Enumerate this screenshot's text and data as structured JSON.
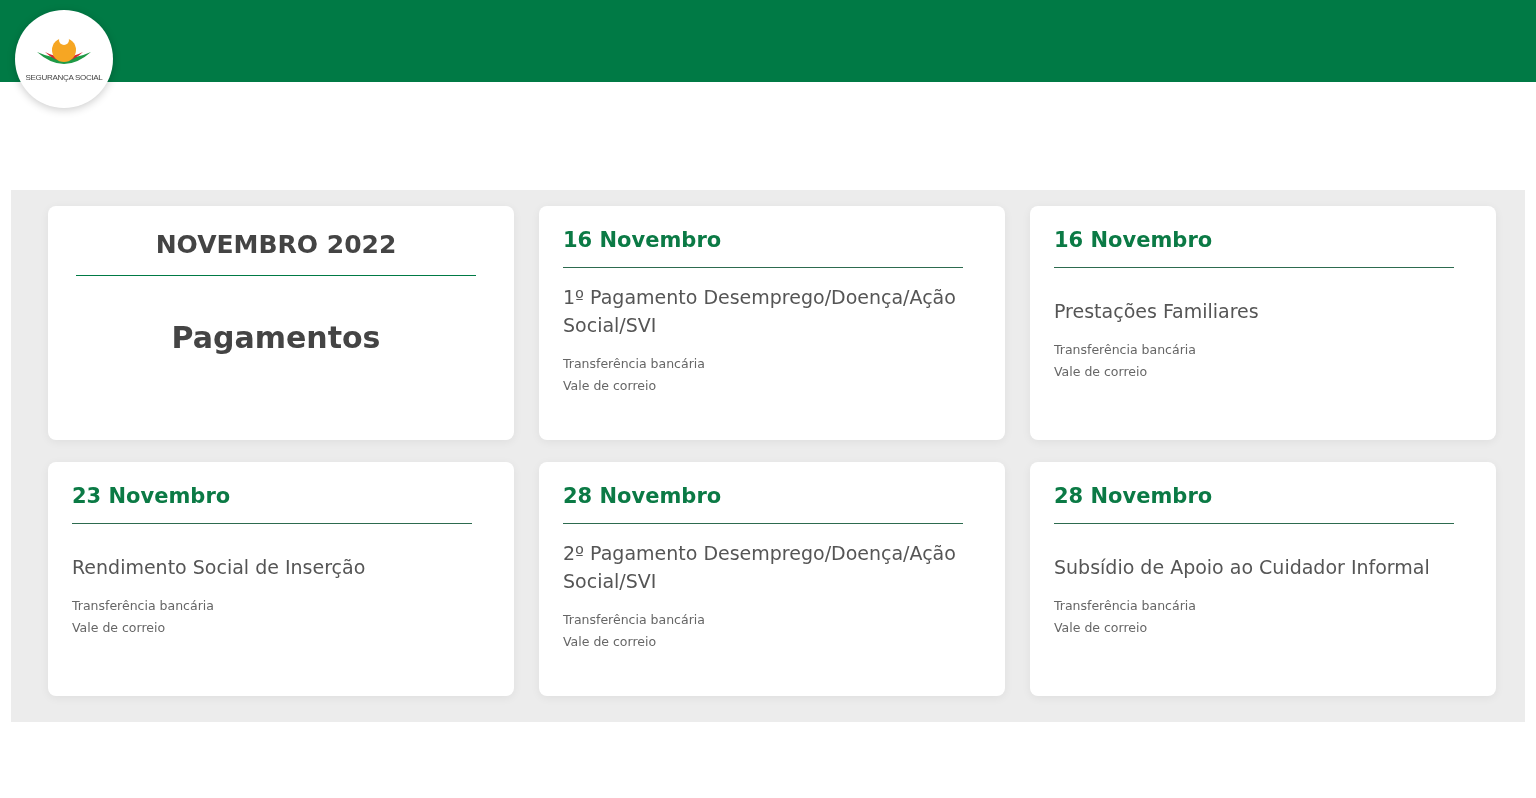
{
  "logo": {
    "text": "SEGURANÇA SOCIAL"
  },
  "summary": {
    "title": "NOVEMBRO 2022",
    "subtitle": "Pagamentos"
  },
  "payments": [
    {
      "date": "16 Novembro",
      "title": "1º Pagamento Desemprego/Doença/Ação Social/SVI",
      "methods": [
        "Transferência bancária",
        "Vale de correio"
      ]
    },
    {
      "date": "16 Novembro",
      "title": "Prestações Familiares",
      "methods": [
        "Transferência bancária",
        "Vale de correio"
      ]
    },
    {
      "date": "23 Novembro",
      "title": "Rendimento Social de Inserção",
      "methods": [
        "Transferência bancária",
        "Vale de correio"
      ]
    },
    {
      "date": "28 Novembro",
      "title": "2º Pagamento Desemprego/Doença/Ação Social/SVI",
      "methods": [
        "Transferência bancária",
        "Vale de correio"
      ]
    },
    {
      "date": "28 Novembro",
      "title": "Subsídio de Apoio ao Cuidador Informal",
      "methods": [
        "Transferência bancária",
        "Vale de correio"
      ]
    }
  ]
}
